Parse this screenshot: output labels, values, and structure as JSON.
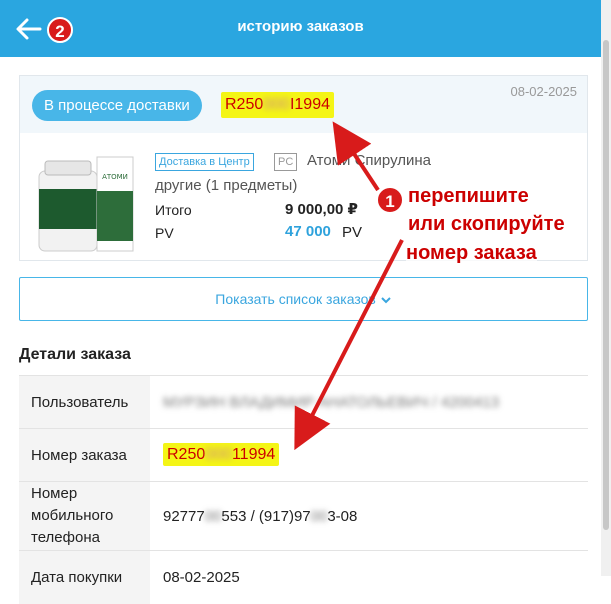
{
  "header": {
    "title": "историю заказов",
    "back_badge": "2"
  },
  "order_card": {
    "status": "В процессе доставки",
    "order_number_start": "R250",
    "order_number_hidden": "000",
    "order_number_end": "I1994",
    "date": "08-02-2025",
    "delivery_tag": "Доставка в Центр",
    "pc_tag": "PC",
    "product_name": "Атоми Спирулина",
    "others": "другие (1 предметы)",
    "total_label": "Итого",
    "total_value": "9 000,00 ₽",
    "pv_label": "PV",
    "pv_value": "47 000",
    "pv_unit": "PV"
  },
  "show_list_button": "Показать список заказов",
  "details": {
    "title": "Детали заказа",
    "rows": [
      {
        "key": "Пользователь",
        "value": "МУРЗИН ВЛАДИМИР АНАТОЛЬЕВИЧ / 4200413"
      },
      {
        "key": "Номер заказа",
        "value": "R250",
        "value_hidden": "000",
        "value_end": "11994"
      },
      {
        "key": "Номер мобильного телефона",
        "value": "92777",
        "value_hidden": "00",
        "value_mid": "553 / (917)97",
        "value_hidden2": "00",
        "value_end": "3-08"
      },
      {
        "key": "Дата покупки",
        "value": "08-02-2025"
      }
    ]
  },
  "annotation": {
    "badge": "1",
    "line1": "перепишите",
    "line2": "или скопируйте",
    "line3": "номер заказа"
  },
  "colors": {
    "header": "#2aa6e0",
    "highlight": "#f4f516",
    "annotation": "#d81b1b",
    "accent": "#3aa6df"
  }
}
